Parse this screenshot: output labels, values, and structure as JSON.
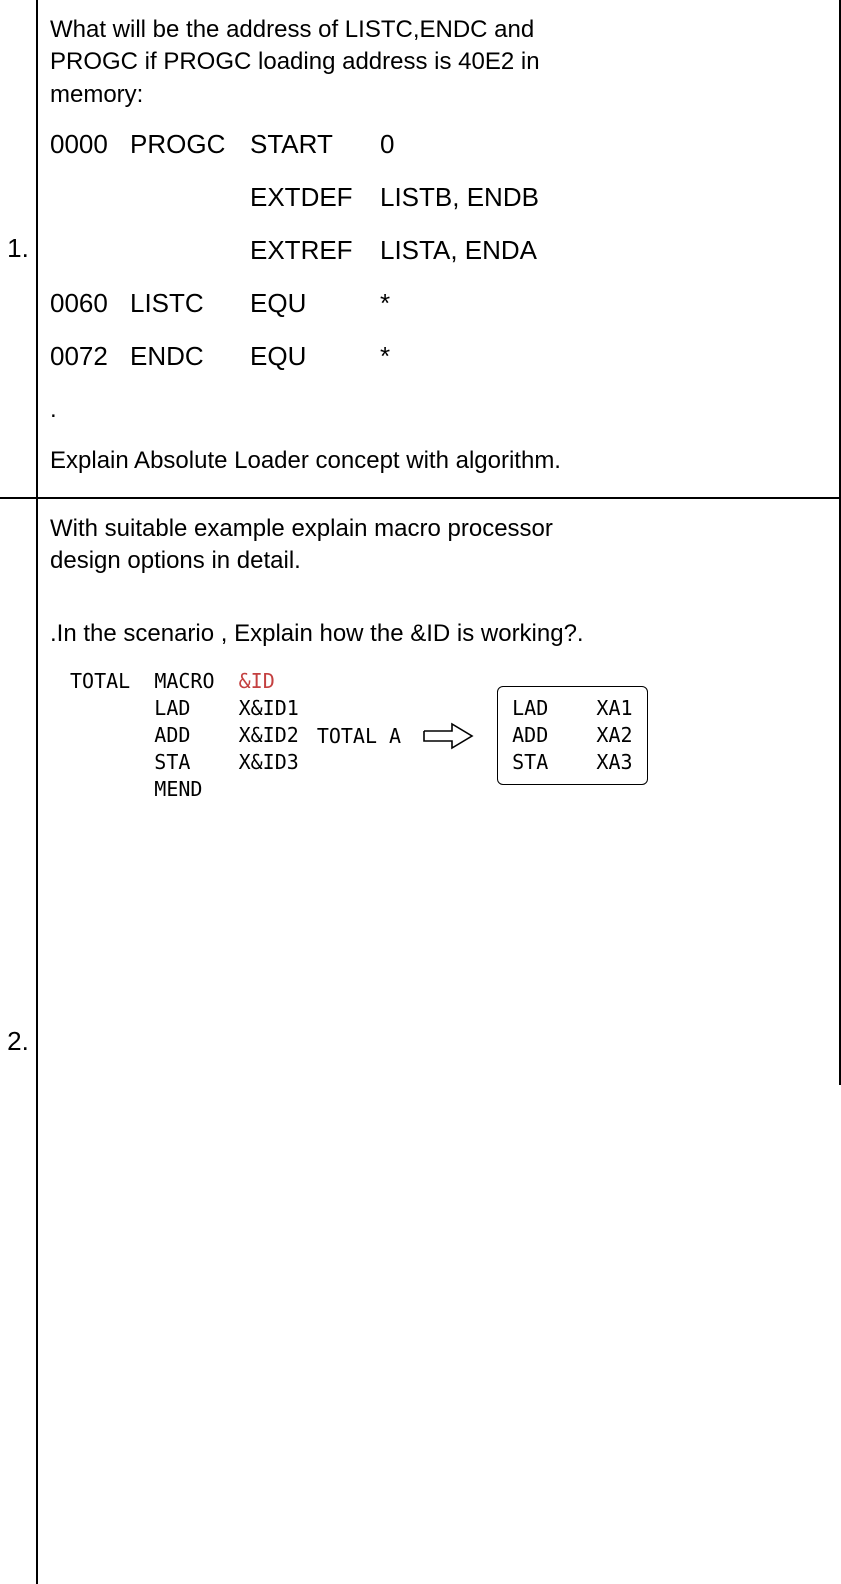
{
  "q1": {
    "number": "1.",
    "intro_lines": [
      "What will be the address of LISTC,ENDC and",
      "PROGC  if PROGC loading address is 40E2 in",
      "memory:"
    ],
    "code": [
      {
        "addr": "0000",
        "label": "PROGC",
        "op": "START",
        "operand": "0"
      },
      {
        "addr": "",
        "label": "",
        "op": "EXTDEF",
        "operand": "LISTB, ENDB"
      },
      {
        "addr": "",
        "label": "",
        "op": "EXTREF",
        "operand": "LISTA, ENDA"
      },
      {
        "addr": "0060",
        "label": "LISTC",
        "op": "EQU",
        "operand": "*"
      },
      {
        "addr": "0072",
        "label": "ENDC",
        "op": "EQU",
        "operand": "*"
      }
    ],
    "dot": ".",
    "tail": "Explain Absolute Loader concept with algorithm."
  },
  "q2": {
    "number": "2.",
    "intro_lines": [
      "With suitable example explain macro processor",
      "design options in detail."
    ],
    "scenario": ".In the scenario , Explain how the &ID is working?.",
    "macro": {
      "head_l": "TOTAL",
      "head_m": "MACRO",
      "head_r": "&ID",
      "rows": [
        {
          "op": "LAD",
          "arg": "X&ID1"
        },
        {
          "op": "ADD",
          "arg": "X&ID2"
        },
        {
          "op": "STA",
          "arg": "X&ID3"
        }
      ],
      "mend": "MEND"
    },
    "call": "TOTAL  A",
    "result_rows": [
      {
        "op": "LAD",
        "arg": "XA1"
      },
      {
        "op": "ADD",
        "arg": "XA2"
      },
      {
        "op": "STA",
        "arg": "XA3"
      }
    ]
  }
}
